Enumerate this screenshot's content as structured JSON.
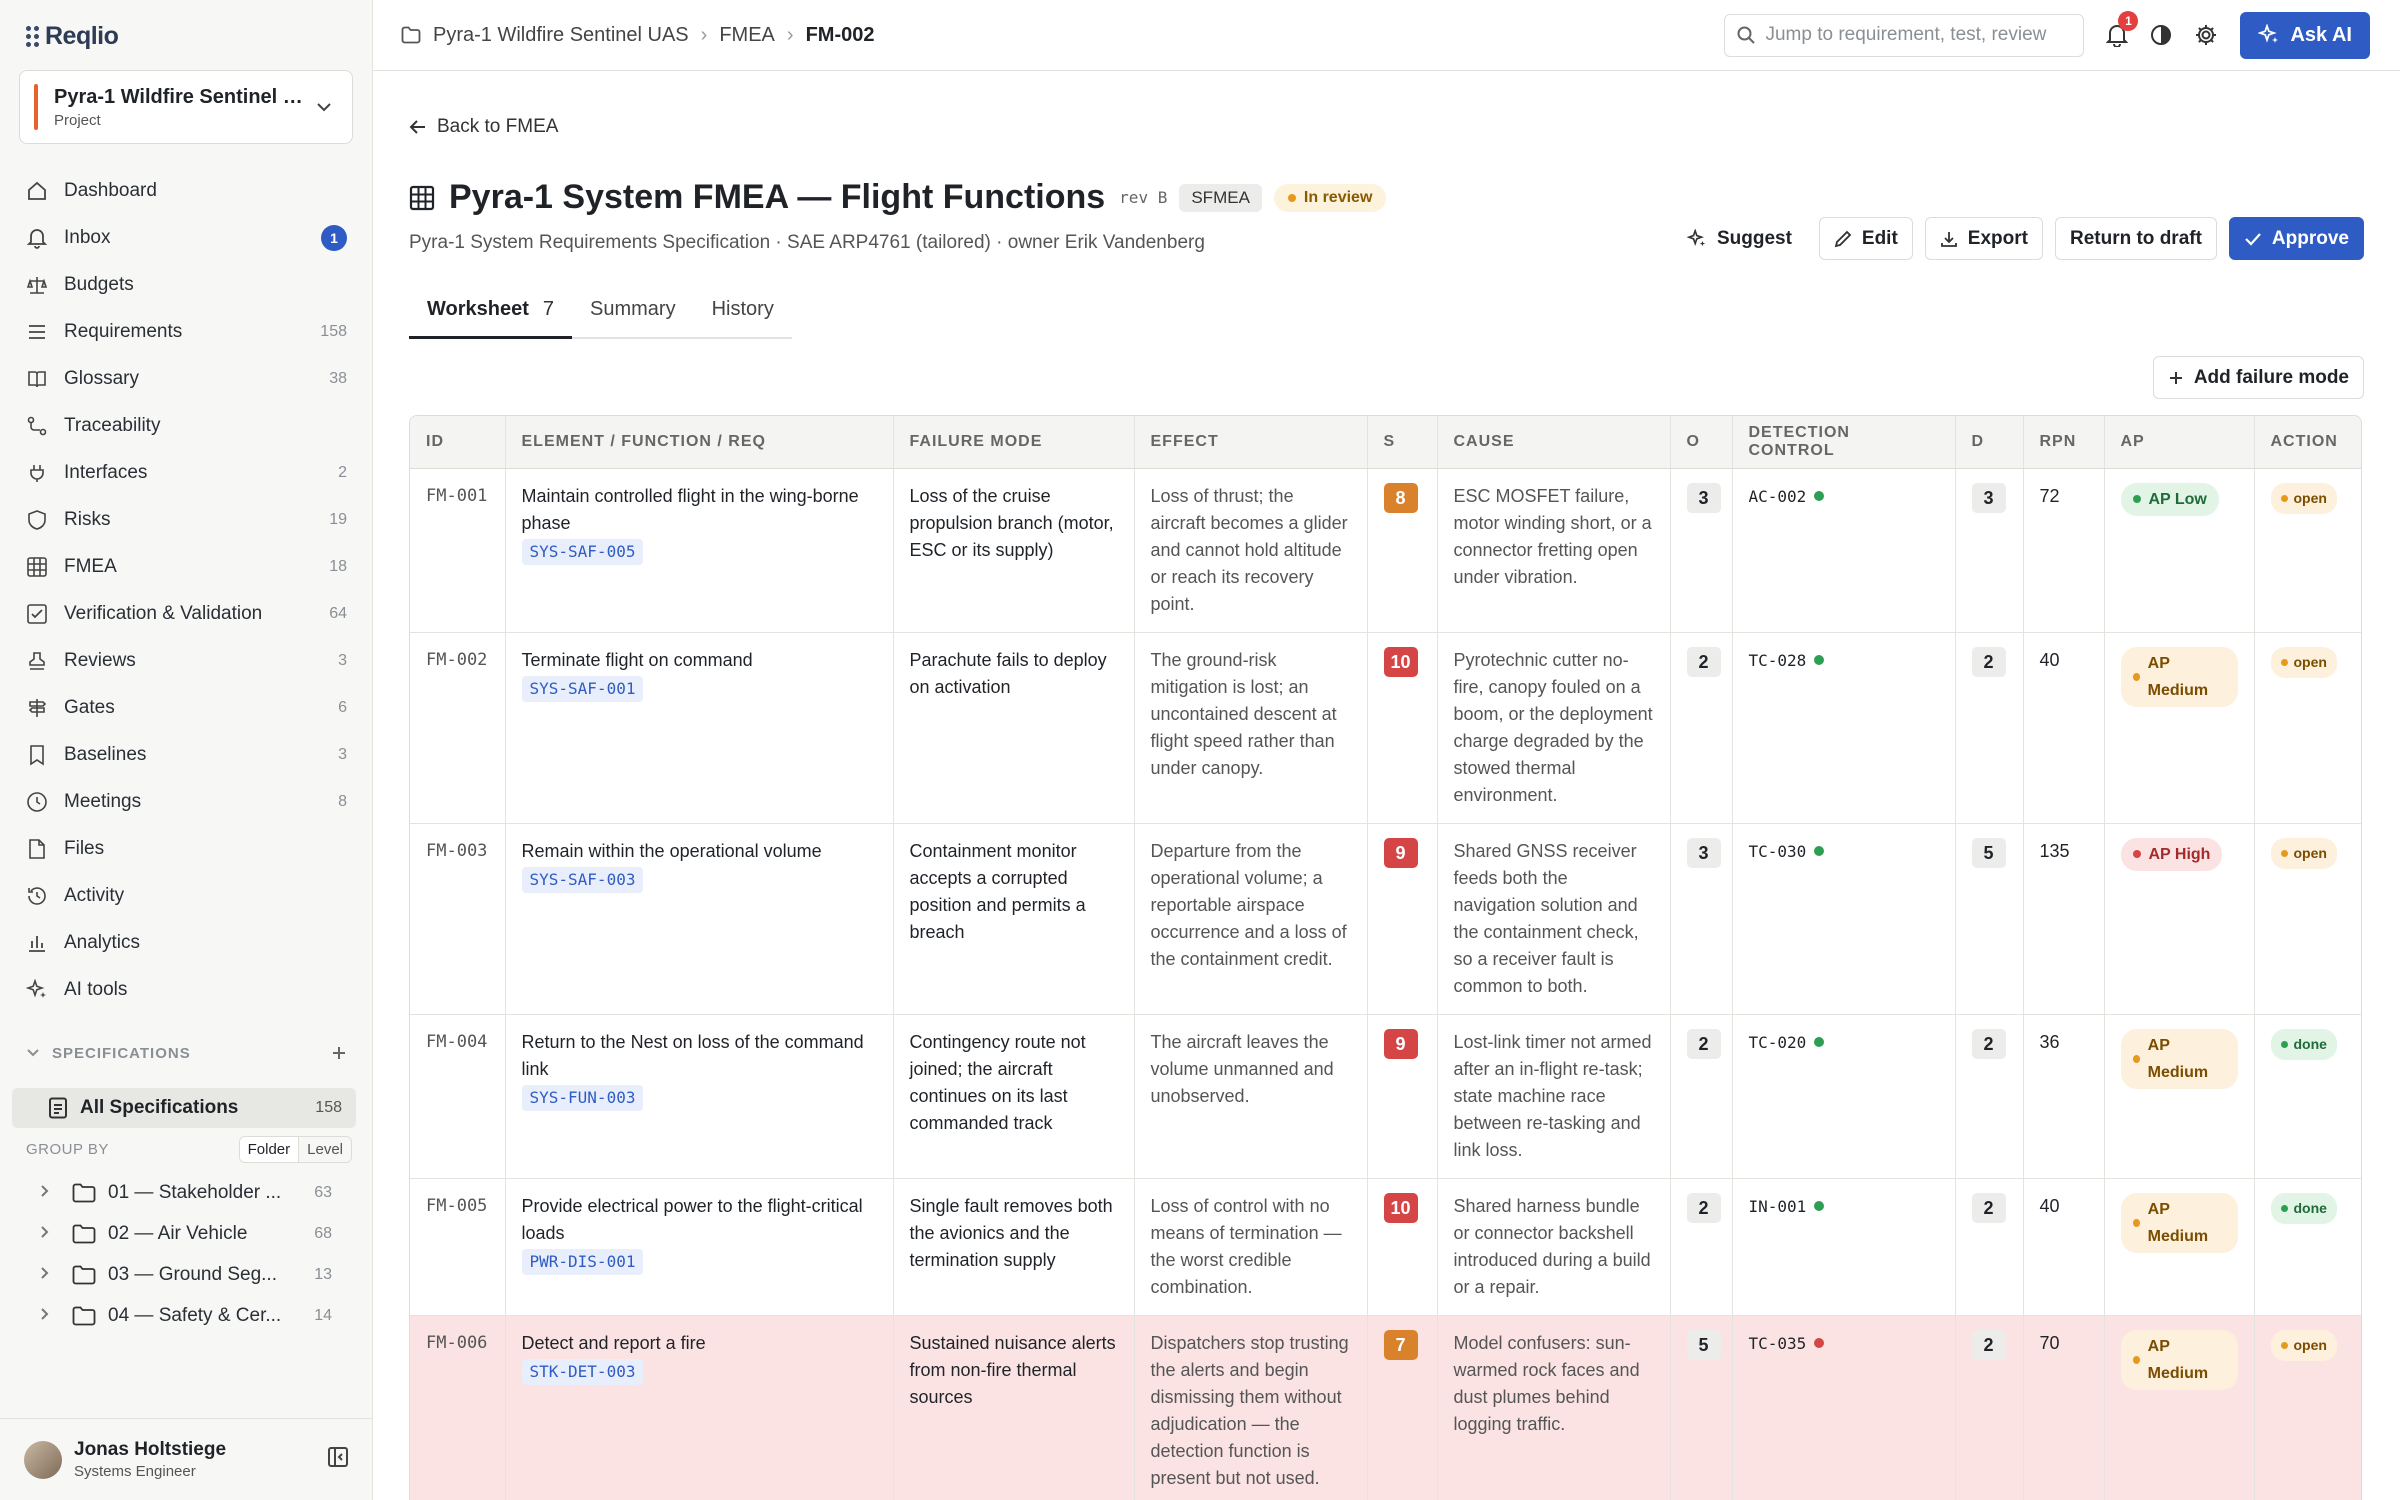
{
  "sidebar": {
    "logo": "Reqlio",
    "project": {
      "name": "Pyra-1 Wildfire Sentinel UAS",
      "type": "Project"
    },
    "nav": [
      {
        "label": "Dashboard",
        "count": "",
        "icon": "home-icon"
      },
      {
        "label": "Inbox",
        "badge": "1",
        "icon": "bell-icon"
      },
      {
        "label": "Budgets",
        "count": "",
        "icon": "scale-icon"
      },
      {
        "label": "Requirements",
        "count": "158",
        "icon": "list-icon"
      },
      {
        "label": "Glossary",
        "count": "38",
        "icon": "book-icon"
      },
      {
        "label": "Traceability",
        "count": "",
        "icon": "network-icon"
      },
      {
        "label": "Interfaces",
        "count": "2",
        "icon": "plug-icon"
      },
      {
        "label": "Risks",
        "count": "19",
        "icon": "shield-icon"
      },
      {
        "label": "FMEA",
        "count": "18",
        "icon": "grid-icon"
      },
      {
        "label": "Verification & Validation",
        "count": "64",
        "icon": "check-square-icon"
      },
      {
        "label": "Reviews",
        "count": "3",
        "icon": "stamp-icon"
      },
      {
        "label": "Gates",
        "count": "6",
        "icon": "signpost-icon"
      },
      {
        "label": "Baselines",
        "count": "3",
        "icon": "bookmark-icon"
      },
      {
        "label": "Meetings",
        "count": "8",
        "icon": "clock-icon"
      },
      {
        "label": "Files",
        "count": "",
        "icon": "file-icon"
      },
      {
        "label": "Activity",
        "count": "",
        "icon": "history-icon"
      },
      {
        "label": "Analytics",
        "count": "",
        "icon": "bar-chart-icon"
      },
      {
        "label": "AI tools",
        "count": "",
        "icon": "sparkle-icon"
      }
    ],
    "specs_header": "SPECIFICATIONS",
    "all_specs": {
      "label": "All Specifications",
      "count": "158"
    },
    "group_by": {
      "label": "GROUP BY",
      "options": [
        "Folder",
        "Level"
      ],
      "selected": "Folder"
    },
    "folders": [
      {
        "label": "01 — Stakeholder ...",
        "count": "63"
      },
      {
        "label": "02 — Air Vehicle",
        "count": "68"
      },
      {
        "label": "03 — Ground Seg...",
        "count": "13"
      },
      {
        "label": "04 — Safety & Cer...",
        "count": "14"
      }
    ],
    "user": {
      "name": "Jonas Holtstiege",
      "role": "Systems Engineer"
    }
  },
  "topbar": {
    "breadcrumbs": [
      "Pyra-1 Wildfire Sentinel UAS",
      "FMEA",
      "FM-002"
    ],
    "search_placeholder": "Jump to requirement, test, review",
    "notif_count": "1",
    "ask_ai": "Ask AI"
  },
  "page": {
    "back": "Back to FMEA",
    "title": "Pyra-1 System FMEA — Flight Functions",
    "rev": "rev B",
    "kind": "SFMEA",
    "status": "In review",
    "subtitle": "Pyra-1 System Requirements Specification · SAE ARP4761 (tailored) · owner Erik Vandenberg",
    "actions": {
      "suggest": "Suggest",
      "edit": "Edit",
      "export": "Export",
      "return": "Return to draft",
      "approve": "Approve"
    },
    "tabs": [
      {
        "label": "Worksheet",
        "count": "7"
      },
      {
        "label": "Summary"
      },
      {
        "label": "History"
      }
    ],
    "add_failure_mode": "Add failure mode"
  },
  "table": {
    "columns": [
      "ID",
      "ELEMENT / FUNCTION / REQ",
      "FAILURE MODE",
      "EFFECT",
      "S",
      "CAUSE",
      "O",
      "DETECTION CONTROL",
      "D",
      "RPN",
      "AP",
      "ACTION"
    ],
    "rows": [
      {
        "id": "FM-001",
        "element": "Maintain controlled flight in the wing-borne phase",
        "req": "SYS-SAF-005",
        "failure": "Loss of the cruise propulsion branch (motor, ESC or its supply)",
        "effect": "Loss of thrust; the aircraft becomes a glider and cannot hold altitude or reach its recovery point.",
        "s": "8",
        "cause": "ESC MOSFET failure, motor winding short, or a connector fretting open under vibration.",
        "o": "3",
        "det": "AC-002",
        "det_color": "#2f9e55",
        "d": "3",
        "rpn": "72",
        "ap": "AP Low",
        "ap_level": "low",
        "action": "open"
      },
      {
        "id": "FM-002",
        "element": "Terminate flight on command",
        "req": "SYS-SAF-001",
        "failure": "Parachute fails to deploy on activation",
        "effect": "The ground-risk mitigation is lost; an uncontained descent at flight speed rather than under canopy.",
        "s": "10",
        "cause": "Pyrotechnic cutter no-fire, canopy fouled on a boom, or the deployment charge degraded by the stowed thermal environment.",
        "o": "2",
        "det": "TC-028",
        "det_color": "#2f9e55",
        "d": "2",
        "rpn": "40",
        "ap": "AP Medium",
        "ap_level": "med",
        "action": "open"
      },
      {
        "id": "FM-003",
        "element": "Remain within the operational volume",
        "req": "SYS-SAF-003",
        "failure": "Containment monitor accepts a corrupted position and permits a breach",
        "effect": "Departure from the operational volume; a reportable airspace occurrence and a loss of the containment credit.",
        "s": "9",
        "cause": "Shared GNSS receiver feeds both the navigation solution and the containment check, so a receiver fault is common to both.",
        "o": "3",
        "det": "TC-030",
        "det_color": "#2f9e55",
        "d": "5",
        "rpn": "135",
        "ap": "AP High",
        "ap_level": "high",
        "action": "open"
      },
      {
        "id": "FM-004",
        "element": "Return to the Nest on loss of the command link",
        "req": "SYS-FUN-003",
        "failure": "Contingency route not joined; the aircraft continues on its last commanded track",
        "effect": "The aircraft leaves the volume unmanned and unobserved.",
        "s": "9",
        "cause": "Lost-link timer not armed after an in-flight re-task; state machine race between re-tasking and link loss.",
        "o": "2",
        "det": "TC-020",
        "det_color": "#2f9e55",
        "d": "2",
        "rpn": "36",
        "ap": "AP Medium",
        "ap_level": "med",
        "action": "done"
      },
      {
        "id": "FM-005",
        "element": "Provide electrical power to the flight-critical loads",
        "req": "PWR-DIS-001",
        "failure": "Single fault removes both the avionics and the termination supply",
        "effect": "Loss of control with no means of termination — the worst credible combination.",
        "s": "10",
        "cause": "Shared harness bundle or connector backshell introduced during a build or a repair.",
        "o": "2",
        "det": "IN-001",
        "det_color": "#2f9e55",
        "d": "2",
        "rpn": "40",
        "ap": "AP Medium",
        "ap_level": "med",
        "action": "done"
      },
      {
        "id": "FM-006",
        "element": "Detect and report a fire",
        "req": "STK-DET-003",
        "failure": "Sustained nuisance alerts from non-fire thermal sources",
        "effect": "Dispatchers stop trusting the alerts and begin dismissing them without adjudication — the detection function is present but not used.",
        "s": "7",
        "cause": "Model confusers: sun-warmed rock faces and dust plumes behind logging traffic.",
        "o": "5",
        "det": "TC-035",
        "det_color": "#d64545",
        "d": "2",
        "rpn": "70",
        "ap": "AP Medium",
        "ap_level": "med",
        "action": "open",
        "highlight": true
      }
    ]
  }
}
